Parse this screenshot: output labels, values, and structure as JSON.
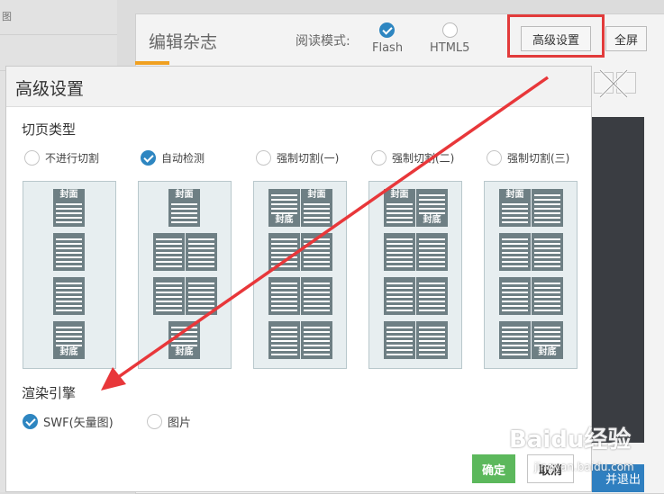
{
  "background": {
    "sidebar_fragment": "图",
    "title": "编辑杂志",
    "reading_mode_label": "阅读模式:",
    "modes": [
      {
        "label": "Flash",
        "checked": true
      },
      {
        "label": "HTML5",
        "checked": false
      }
    ],
    "advanced_button": "高级设置",
    "fullscreen_button": "全屏",
    "exit_button_fragment": "并退出"
  },
  "modal": {
    "title": "高级设置",
    "page_split": {
      "title": "切页类型",
      "options": [
        {
          "label": "不进行切割",
          "checked": false
        },
        {
          "label": "自动检测",
          "checked": true
        },
        {
          "label": "强制切割(一)",
          "checked": false
        },
        {
          "label": "强制切割(二)",
          "checked": false
        },
        {
          "label": "强制切割(三)",
          "checked": false
        }
      ],
      "cover_label": "封面",
      "back_cover_label": "封底"
    },
    "render_engine": {
      "title": "渲染引擎",
      "options": [
        {
          "label": "SWF(矢量图)",
          "checked": true
        },
        {
          "label": "图片",
          "checked": false
        }
      ]
    },
    "ok_button": "确定",
    "cancel_button": "取消"
  },
  "watermark": {
    "brand": "Baidu经验",
    "url": "jingyan.baidu.com"
  },
  "colors": {
    "accent_blue": "#2e86c1",
    "highlight_red": "#e23b3b",
    "confirm_green": "#5cb85c",
    "page_gray": "#6e7f84"
  }
}
